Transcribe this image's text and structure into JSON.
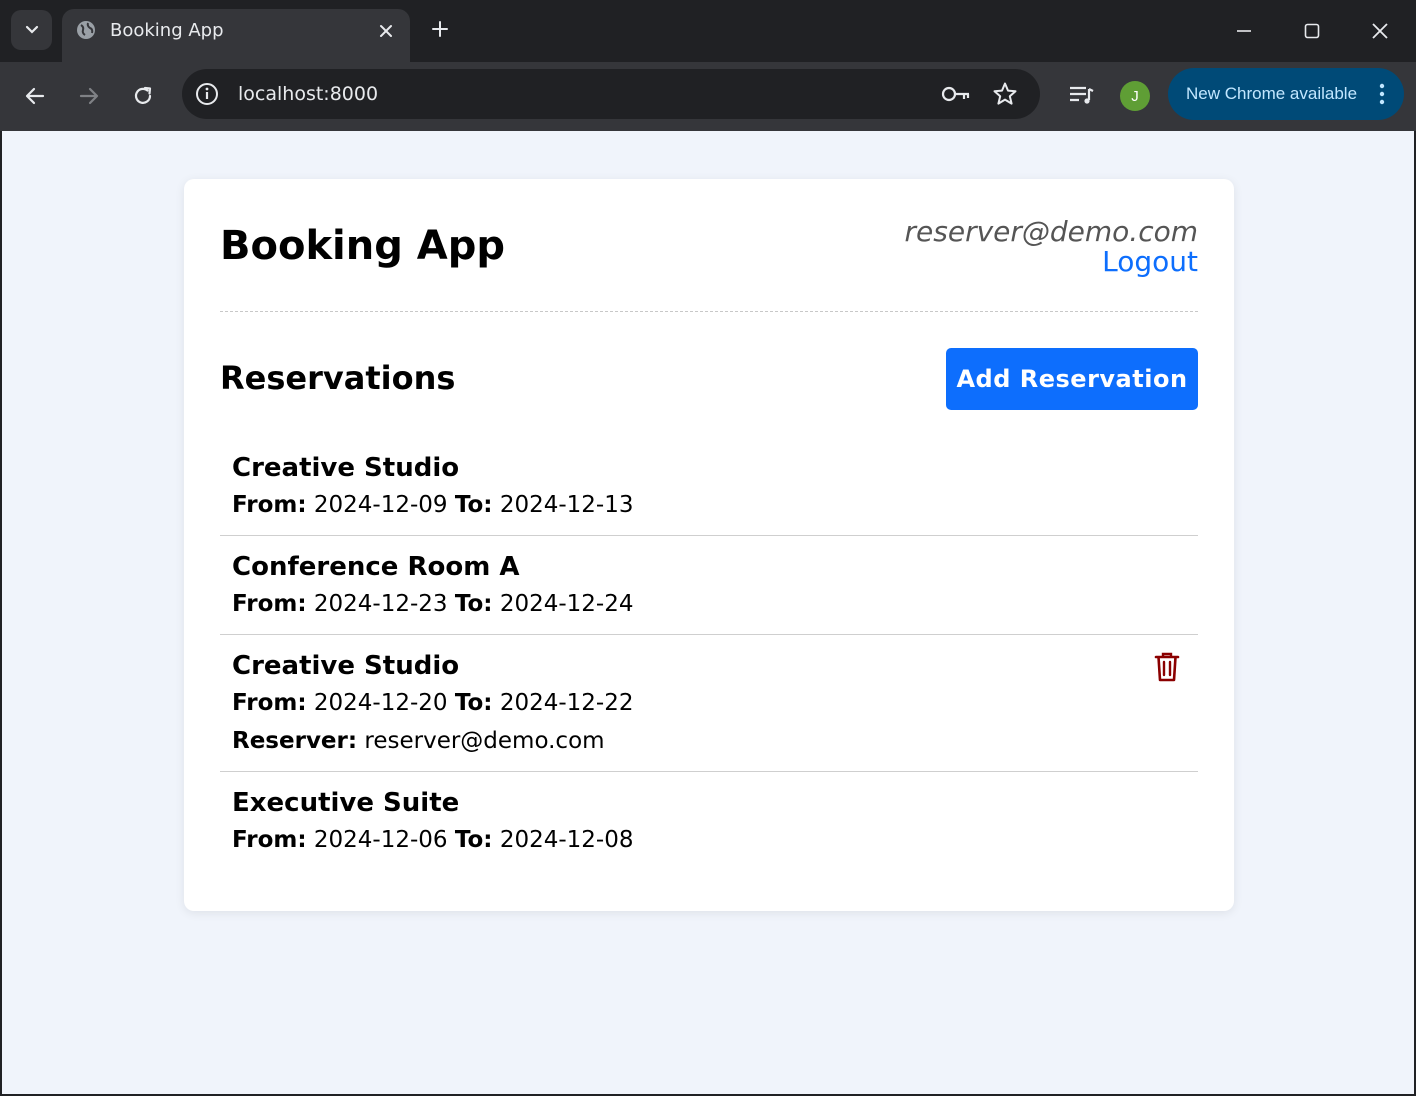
{
  "browser": {
    "tab_title": "Booking App",
    "url": "localhost:8000",
    "profile_initial": "J",
    "update_label": "New Chrome available"
  },
  "app": {
    "title": "Booking App",
    "user_email": "reserver@demo.com",
    "logout_label": "Logout",
    "section_title": "Reservations",
    "add_button_label": "Add Reservation",
    "from_label": "From:",
    "to_label": "To:",
    "reserver_label": "Reserver:"
  },
  "reservations": [
    {
      "name": "Creative Studio",
      "from": "2024-12-09",
      "to": "2024-12-13"
    },
    {
      "name": "Conference Room A",
      "from": "2024-12-23",
      "to": "2024-12-24"
    },
    {
      "name": "Creative Studio",
      "from": "2024-12-20",
      "to": "2024-12-22",
      "reserver": "reserver@demo.com",
      "deletable": true
    },
    {
      "name": "Executive Suite",
      "from": "2024-12-06",
      "to": "2024-12-08"
    }
  ],
  "colors": {
    "accent": "#0d6efd",
    "delete": "#8b0000",
    "page_bg": "#f0f4fb"
  }
}
